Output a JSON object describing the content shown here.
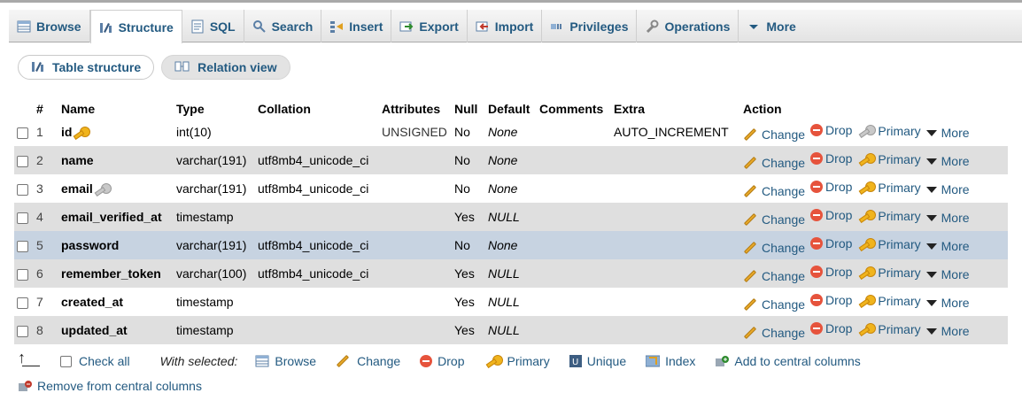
{
  "tabs": [
    {
      "label": "Browse",
      "icon": "browse-icon",
      "active": false
    },
    {
      "label": "Structure",
      "icon": "structure-icon",
      "active": true
    },
    {
      "label": "SQL",
      "icon": "sql-icon",
      "active": false
    },
    {
      "label": "Search",
      "icon": "search-icon",
      "active": false
    },
    {
      "label": "Insert",
      "icon": "insert-icon",
      "active": false
    },
    {
      "label": "Export",
      "icon": "export-icon",
      "active": false
    },
    {
      "label": "Import",
      "icon": "import-icon",
      "active": false
    },
    {
      "label": "Privileges",
      "icon": "privileges-icon",
      "active": false
    },
    {
      "label": "Operations",
      "icon": "operations-icon",
      "active": false
    },
    {
      "label": "More",
      "icon": "chevron-down-icon",
      "active": false
    }
  ],
  "subtabs": {
    "table_structure": "Table structure",
    "relation_view": "Relation view"
  },
  "columns": {
    "num": "#",
    "name": "Name",
    "type": "Type",
    "collation": "Collation",
    "attributes": "Attributes",
    "null": "Null",
    "default": "Default",
    "comments": "Comments",
    "extra": "Extra",
    "action": "Action"
  },
  "rows": [
    {
      "num": "1",
      "name": "id",
      "key": "primary",
      "type": "int(10)",
      "collation": "",
      "attributes": "UNSIGNED",
      "null": "No",
      "default": "None",
      "extra": "AUTO_INCREMENT"
    },
    {
      "num": "2",
      "name": "name",
      "key": "",
      "type": "varchar(191)",
      "collation": "utf8mb4_unicode_ci",
      "attributes": "",
      "null": "No",
      "default": "None",
      "extra": ""
    },
    {
      "num": "3",
      "name": "email",
      "key": "unique",
      "type": "varchar(191)",
      "collation": "utf8mb4_unicode_ci",
      "attributes": "",
      "null": "No",
      "default": "None",
      "extra": ""
    },
    {
      "num": "4",
      "name": "email_verified_at",
      "key": "",
      "type": "timestamp",
      "collation": "",
      "attributes": "",
      "null": "Yes",
      "default": "NULL",
      "extra": ""
    },
    {
      "num": "5",
      "name": "password",
      "key": "",
      "type": "varchar(191)",
      "collation": "utf8mb4_unicode_ci",
      "attributes": "",
      "null": "No",
      "default": "None",
      "extra": ""
    },
    {
      "num": "6",
      "name": "remember_token",
      "key": "",
      "type": "varchar(100)",
      "collation": "utf8mb4_unicode_ci",
      "attributes": "",
      "null": "Yes",
      "default": "NULL",
      "extra": ""
    },
    {
      "num": "7",
      "name": "created_at",
      "key": "",
      "type": "timestamp",
      "collation": "",
      "attributes": "",
      "null": "Yes",
      "default": "NULL",
      "extra": ""
    },
    {
      "num": "8",
      "name": "updated_at",
      "key": "",
      "type": "timestamp",
      "collation": "",
      "attributes": "",
      "null": "Yes",
      "default": "NULL",
      "extra": ""
    }
  ],
  "row_actions": {
    "change": "Change",
    "drop": "Drop",
    "primary": "Primary",
    "more": "More"
  },
  "footer": {
    "check_all": "Check all",
    "with_selected": "With selected:",
    "browse": "Browse",
    "change": "Change",
    "drop": "Drop",
    "primary": "Primary",
    "unique": "Unique",
    "index": "Index",
    "add_central": "Add to central columns",
    "remove_central": "Remove from central columns"
  },
  "colors": {
    "link": "#235a81",
    "row_even": "#dfdfdf",
    "row_highlight": "#c7d3e1"
  }
}
